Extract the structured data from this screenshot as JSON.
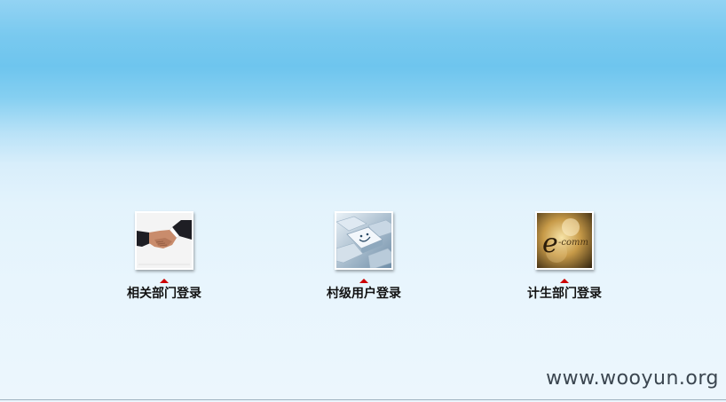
{
  "logins": [
    {
      "label": "相关部门登录",
      "icon": "handshake-icon"
    },
    {
      "label": "村级用户登录",
      "icon": "smiley-keyboard-icon"
    },
    {
      "label": "计生部门登录",
      "icon": "e-commerce-icon"
    }
  ],
  "watermark": "www.wooyun.org",
  "colors": {
    "arrow": "#cc0000",
    "label": "#111111",
    "sky_top": "#79c9ef",
    "sky_bottom": "#ecf6fd"
  }
}
